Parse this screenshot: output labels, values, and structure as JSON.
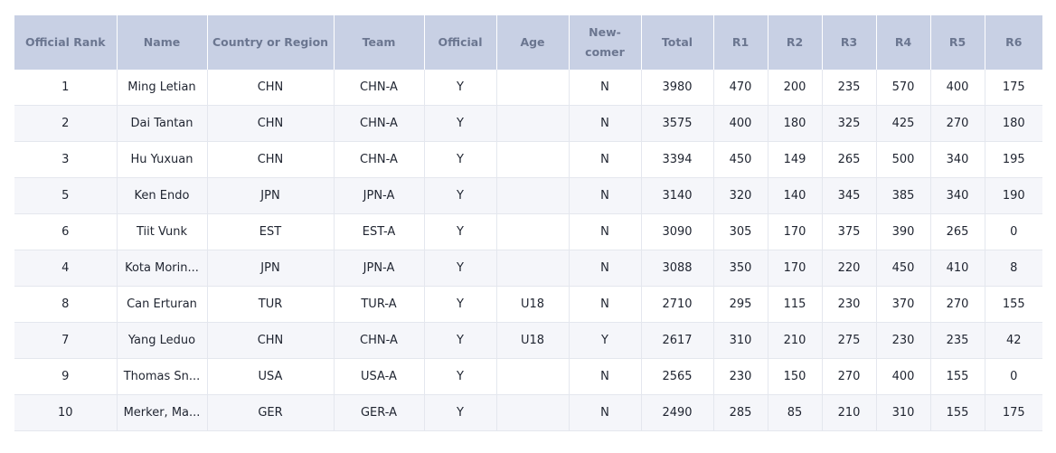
{
  "table": {
    "headers": [
      "Official Rank",
      "Name",
      "Country or Region",
      "Team",
      "Official",
      "Age",
      "New-\ncomer",
      "Total",
      "R1",
      "R2",
      "R3",
      "R4",
      "R5",
      "R6"
    ],
    "rows": [
      [
        "1",
        "Ming Letian",
        "CHN",
        "CHN-A",
        "Y",
        "",
        "N",
        "3980",
        "470",
        "200",
        "235",
        "570",
        "400",
        "175"
      ],
      [
        "2",
        "Dai Tantan",
        "CHN",
        "CHN-A",
        "Y",
        "",
        "N",
        "3575",
        "400",
        "180",
        "325",
        "425",
        "270",
        "180"
      ],
      [
        "3",
        "Hu Yuxuan",
        "CHN",
        "CHN-A",
        "Y",
        "",
        "N",
        "3394",
        "450",
        "149",
        "265",
        "500",
        "340",
        "195"
      ],
      [
        "5",
        "Ken Endo",
        "JPN",
        "JPN-A",
        "Y",
        "",
        "N",
        "3140",
        "320",
        "140",
        "345",
        "385",
        "340",
        "190"
      ],
      [
        "6",
        "Tiit Vunk",
        "EST",
        "EST-A",
        "Y",
        "",
        "N",
        "3090",
        "305",
        "170",
        "375",
        "390",
        "265",
        "0"
      ],
      [
        "4",
        "Kota Morin...",
        "JPN",
        "JPN-A",
        "Y",
        "",
        "N",
        "3088",
        "350",
        "170",
        "220",
        "450",
        "410",
        "8"
      ],
      [
        "8",
        "Can Erturan",
        "TUR",
        "TUR-A",
        "Y",
        "U18",
        "N",
        "2710",
        "295",
        "115",
        "230",
        "370",
        "270",
        "155"
      ],
      [
        "7",
        "Yang Leduo",
        "CHN",
        "CHN-A",
        "Y",
        "U18",
        "Y",
        "2617",
        "310",
        "210",
        "275",
        "230",
        "235",
        "42"
      ],
      [
        "9",
        "Thomas Sn...",
        "USA",
        "USA-A",
        "Y",
        "",
        "N",
        "2565",
        "230",
        "150",
        "270",
        "400",
        "155",
        "0"
      ],
      [
        "10",
        "Merker, Ma...",
        "GER",
        "GER-A",
        "Y",
        "",
        "N",
        "2490",
        "285",
        "85",
        "210",
        "310",
        "155",
        "175"
      ]
    ]
  }
}
